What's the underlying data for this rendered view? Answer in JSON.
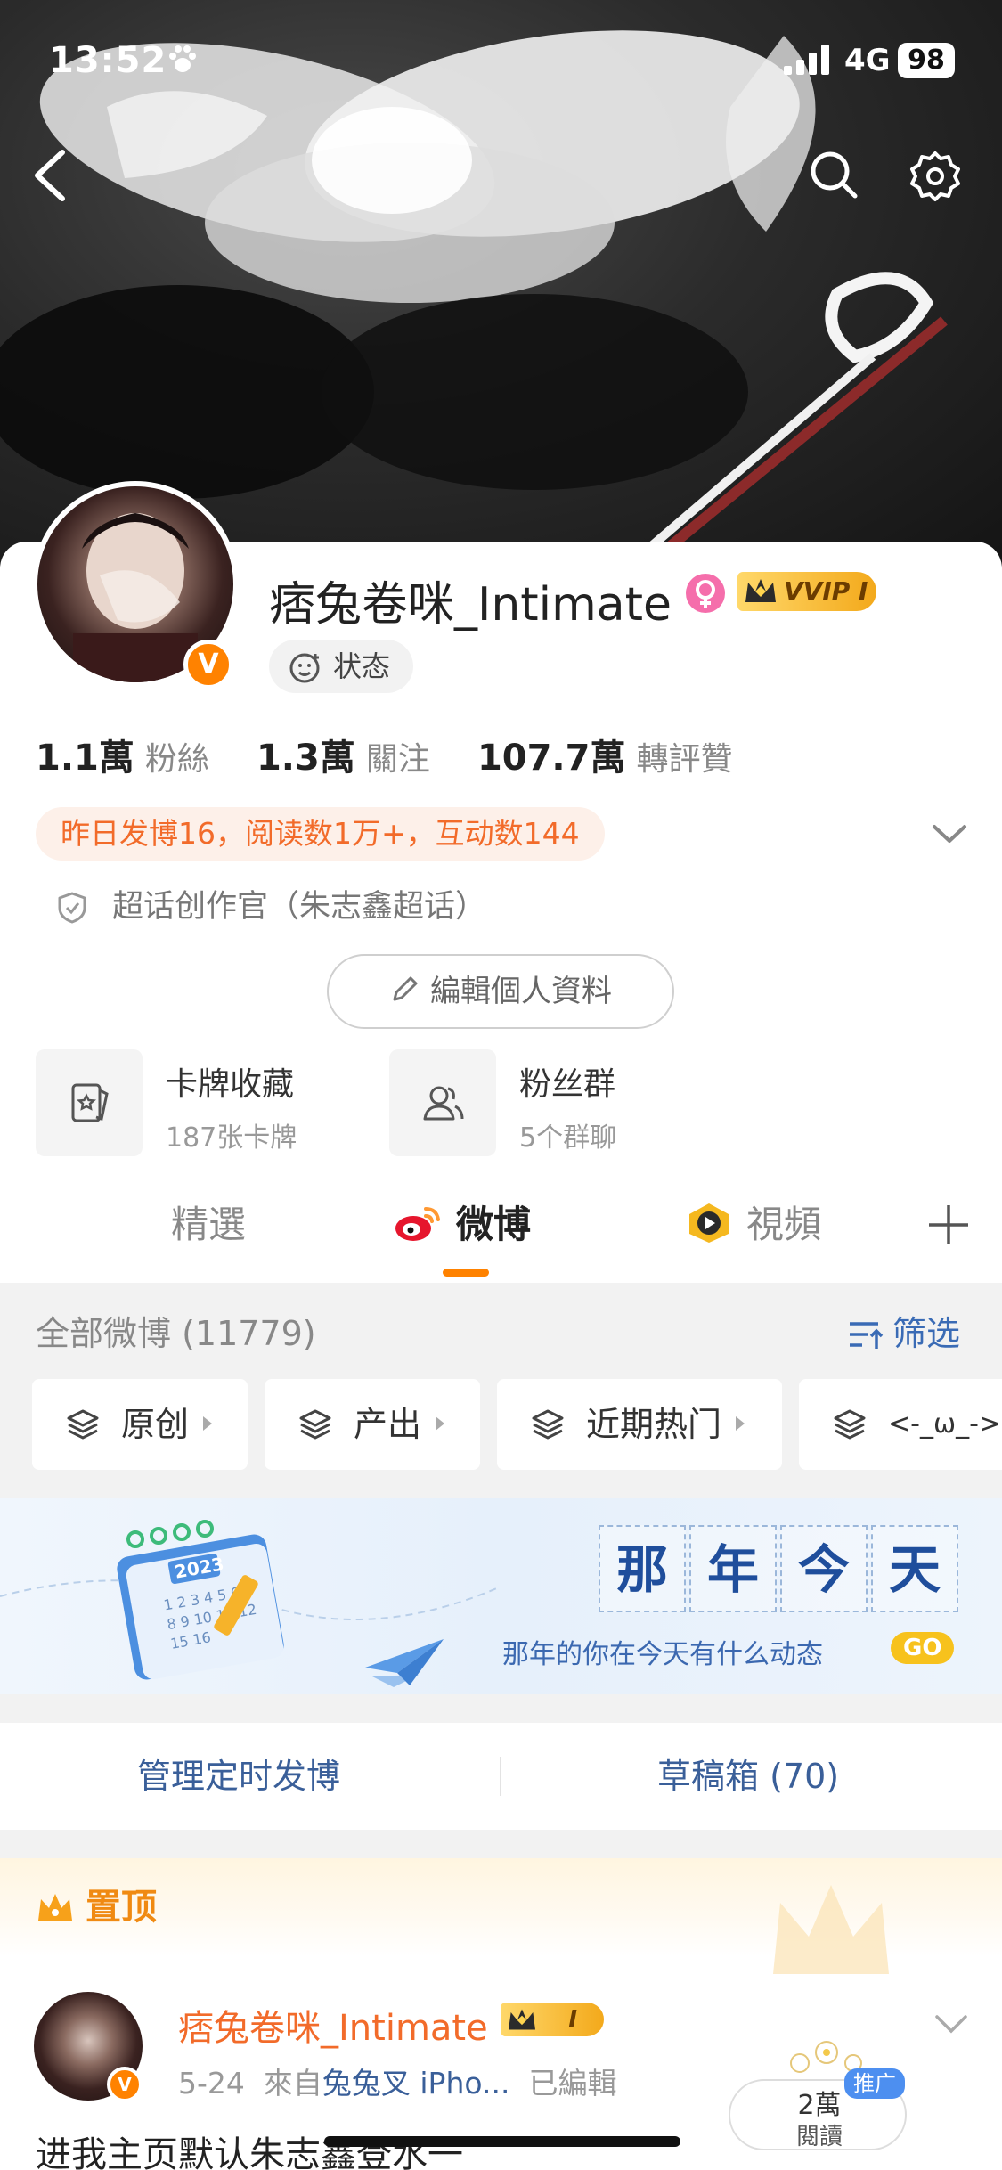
{
  "status_bar": {
    "time": "13:52",
    "network": "4G",
    "battery": "98"
  },
  "profile": {
    "username": "痞兔卷咪_Intimate",
    "vip_badge": "VVIP I",
    "status_label": "状态",
    "stats": [
      {
        "num": "1.1萬",
        "label": "粉絲"
      },
      {
        "num": "1.3萬",
        "label": "關注"
      },
      {
        "num": "107.7萬",
        "label": "轉評贊"
      }
    ],
    "activity": "昨日发博16，阅读数1万+，互动数144",
    "supertopic_role": "超话创作官（朱志鑫超话）",
    "edit_button": "編輯個人資料",
    "tiles": [
      {
        "title": "卡牌收藏",
        "sub": "187张卡牌"
      },
      {
        "title": "粉丝群",
        "sub": "5个群聊"
      }
    ]
  },
  "tabs": [
    {
      "label": "精選",
      "active": false
    },
    {
      "label": "微博",
      "active": true
    },
    {
      "label": "視頻",
      "active": false
    }
  ],
  "feed": {
    "header": "全部微博 (11779)",
    "filter_label": "筛选",
    "chips": [
      "原创",
      "产出",
      "近期热门",
      "<-_ω_->"
    ],
    "memory_chars": [
      "那",
      "年",
      "今",
      "天"
    ],
    "memory_sub": "那年的你在今天有什么动态",
    "memory_go": "GO",
    "memory_calendar_year": "2023",
    "manage_scheduled": "管理定时发博",
    "drafts": "草稿箱 (70)"
  },
  "pinned_post": {
    "pinned_label": "置顶",
    "username": "痞兔卷咪_Intimate",
    "vip_level": "I",
    "date": "5-24",
    "from_label": "來自",
    "source": "兔兔叉 iPho...",
    "edited": "已編輯",
    "read_count": "2萬",
    "read_label": "閱讀",
    "promo": "推广",
    "text": "进我主页默认朱志鑫登水一"
  },
  "colors": {
    "accent_orange": "#ff8200",
    "link_blue": "#3a5f99",
    "activity_orange": "#f26b2a"
  }
}
